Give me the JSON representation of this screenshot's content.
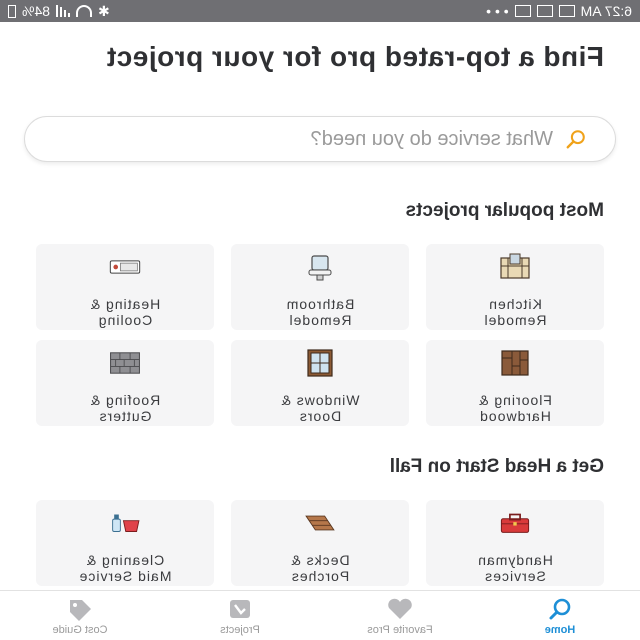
{
  "status_bar": {
    "time": "6:27 AM",
    "battery": "84%",
    "dots": "• • •"
  },
  "hero": {
    "title": "Find a top-rated pro for your project"
  },
  "search": {
    "placeholder": "What service do you need?"
  },
  "popular": {
    "title": "Most popular projects",
    "items": [
      {
        "label": "Kitchen\nRemodel",
        "icon": "kitchen-icon"
      },
      {
        "label": "Bathroom\nRemodel",
        "icon": "bathroom-icon"
      },
      {
        "label": "Heating &\nCooling",
        "icon": "thermostat-icon"
      },
      {
        "label": "Flooring &\nHardwood",
        "icon": "flooring-icon"
      },
      {
        "label": "Windows &\nDoors",
        "icon": "window-icon"
      },
      {
        "label": "Roofing &\nGutters",
        "icon": "brick-icon"
      }
    ]
  },
  "fall": {
    "title": "Get a Head Start on Fall",
    "items": [
      {
        "label": "Handyman\nServices",
        "icon": "toolbox-icon"
      },
      {
        "label": "Decks &\nPorches",
        "icon": "deck-icon"
      },
      {
        "label": "Cleaning &\nMaid Service",
        "icon": "cleaning-icon"
      }
    ]
  },
  "bottom_nav": [
    {
      "label": "Home",
      "icon": "search-icon",
      "active": true
    },
    {
      "label": "Favorite Pros",
      "icon": "heart-icon",
      "active": false
    },
    {
      "label": "Projects",
      "icon": "checkbox-icon",
      "active": false
    },
    {
      "label": "Cost Guide",
      "icon": "price-tag-icon",
      "active": false
    }
  ],
  "colors": {
    "accent": "#1e8fd6",
    "search_icon": "#f0a21a",
    "card_bg": "#f5f5f6",
    "status_bar": "#6f6f73"
  }
}
